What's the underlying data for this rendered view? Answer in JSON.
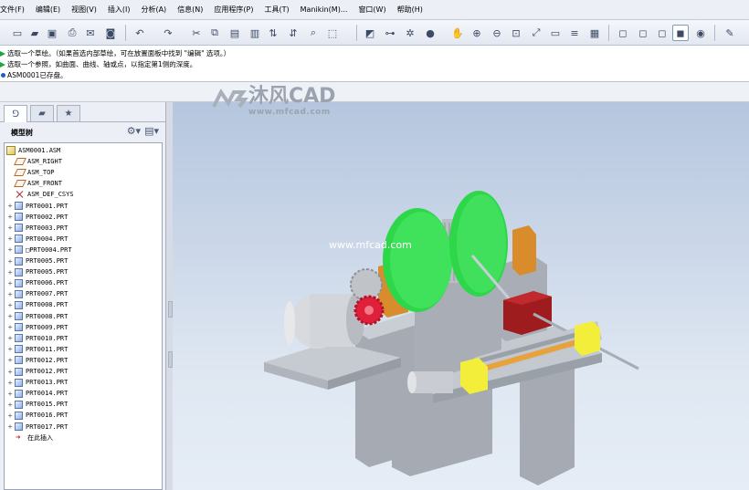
{
  "menu": [
    "文件(F)",
    "编辑(E)",
    "视图(V)",
    "插入(I)",
    "分析(A)",
    "信息(N)",
    "应用程序(P)",
    "工具(T)",
    "Manikin(M)...",
    "窗口(W)",
    "帮助(H)"
  ],
  "messages": [
    {
      "marker": "green-arrow",
      "text": "选取一个草绘。（如果首选内部草绘，可在放置面板中找到 \"编辑\" 选项。）"
    },
    {
      "marker": "green-arrow",
      "text": "选取一个参照，如曲面、曲线、轴或点，以指定第1侧的深度。"
    },
    {
      "marker": "blue-dot",
      "text": "ASM0001已存盘。"
    }
  ],
  "watermark": {
    "brand": "沐风CAD",
    "url": "www.mfcad.com",
    "center_url": "www.mfcad.com"
  },
  "model_tree": {
    "title": "模型树",
    "items": [
      {
        "label": "ASM0001.ASM",
        "icon": "assembly-icon",
        "expandable": false,
        "indent": 0
      },
      {
        "label": "ASM_RIGHT",
        "icon": "datum-plane-icon",
        "expandable": false,
        "indent": 1
      },
      {
        "label": "ASM_TOP",
        "icon": "datum-plane-icon",
        "expandable": false,
        "indent": 1
      },
      {
        "label": "ASM_FRONT",
        "icon": "datum-plane-icon",
        "expandable": false,
        "indent": 1
      },
      {
        "label": "ASM_DEF_CSYS",
        "icon": "csys-icon",
        "expandable": false,
        "indent": 1
      },
      {
        "label": "PRT0001.PRT",
        "icon": "part-icon",
        "expandable": true,
        "indent": 0
      },
      {
        "label": "PRT0002.PRT",
        "icon": "part-icon",
        "expandable": true,
        "indent": 0
      },
      {
        "label": "PRT0003.PRT",
        "icon": "part-icon",
        "expandable": true,
        "indent": 0
      },
      {
        "label": "PRT0004.PRT",
        "icon": "part-icon",
        "expandable": true,
        "indent": 0
      },
      {
        "label": "□PRT0004.PRT",
        "icon": "part-icon",
        "expandable": true,
        "indent": 0
      },
      {
        "label": "PRT0005.PRT",
        "icon": "part-icon",
        "expandable": true,
        "indent": 0
      },
      {
        "label": "PRT0005.PRT",
        "icon": "part-icon",
        "expandable": true,
        "indent": 0
      },
      {
        "label": "PRT0006.PRT",
        "icon": "part-icon",
        "expandable": true,
        "indent": 0
      },
      {
        "label": "PRT0007.PRT",
        "icon": "part-icon",
        "expandable": true,
        "indent": 0
      },
      {
        "label": "PRT0008.PRT",
        "icon": "part-icon",
        "expandable": true,
        "indent": 0
      },
      {
        "label": "PRT0008.PRT",
        "icon": "part-icon",
        "expandable": true,
        "indent": 0
      },
      {
        "label": "PRT0009.PRT",
        "icon": "part-icon",
        "expandable": true,
        "indent": 0
      },
      {
        "label": "PRT0010.PRT",
        "icon": "part-icon",
        "expandable": true,
        "indent": 0
      },
      {
        "label": "PRT0011.PRT",
        "icon": "part-icon",
        "expandable": true,
        "indent": 0
      },
      {
        "label": "PRT0012.PRT",
        "icon": "part-icon",
        "expandable": true,
        "indent": 0
      },
      {
        "label": "PRT0012.PRT",
        "icon": "part-icon",
        "expandable": true,
        "indent": 0
      },
      {
        "label": "PRT0013.PRT",
        "icon": "part-icon",
        "expandable": true,
        "indent": 0
      },
      {
        "label": "PRT0014.PRT",
        "icon": "part-icon",
        "expandable": true,
        "indent": 0
      },
      {
        "label": "PRT0015.PRT",
        "icon": "part-icon",
        "expandable": true,
        "indent": 0
      },
      {
        "label": "PRT0016.PRT",
        "icon": "part-icon",
        "expandable": true,
        "indent": 0
      },
      {
        "label": "PRT0017.PRT",
        "icon": "part-icon",
        "expandable": true,
        "indent": 0
      },
      {
        "label": "在此插入",
        "icon": "insert-here-icon",
        "expandable": false,
        "indent": 1
      }
    ]
  },
  "colors": {
    "gear_green": "#2ed64a",
    "drum_gray": "#b9bec6",
    "frame_gray": "#b8bcc3",
    "bracket_orange": "#d98c2b",
    "gear_red": "#e0203a",
    "block_red": "#9e1b1e",
    "rail_yellow": "#f2ee3a",
    "shaft_orange": "#e8a23c"
  }
}
